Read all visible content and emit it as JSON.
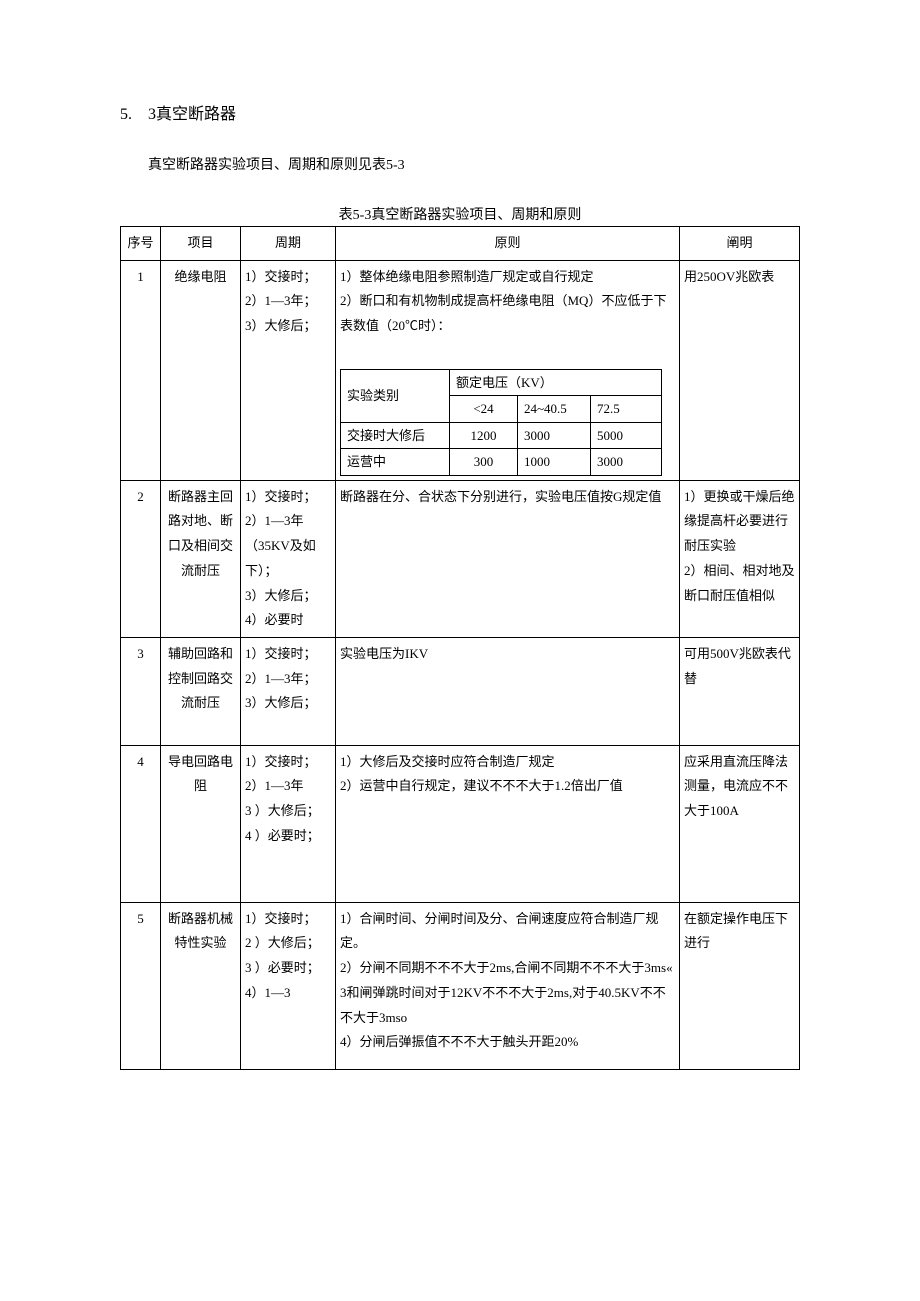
{
  "section_title": "5.　3真空断路器",
  "intro": "真空断路器实验项目、周期和原则见表5-3",
  "table_caption": "表5-3真空断路器实验项目、周期和原则",
  "headers": {
    "seq": "序号",
    "item": "项目",
    "period": "周期",
    "principle": "原则",
    "note": "阐明"
  },
  "row1": {
    "seq": "1",
    "item": "绝缘电阻",
    "period": "1）交接时；\n2）1—3年；\n3）大修后；",
    "principle_top": "1）整体绝缘电阻参照制造厂规定或自行规定\n2）断口和有机物制成提高杆绝缘电阻（MQ）不应低于下表数值（20℃时）：",
    "note": "用250OV兆欧表",
    "inner": {
      "h1": "实验类别",
      "h2": "额定电压（KV）",
      "c1": "<24",
      "c2": "24~40.5",
      "c3": "72.5",
      "r1_label": "交接时大修后",
      "r1_1": "1200",
      "r1_2": "3000",
      "r1_3": "5000",
      "r2_label": "运营中",
      "r2_1": "300",
      "r2_2": "1000",
      "r2_3": "3000"
    }
  },
  "row2": {
    "seq": "2",
    "item": "断路器主回路对地、断口及相间交流耐压",
    "period": "1）交接时；\n2）1—3年（35KV及如下）；\n3）大修后；\n4）必要时",
    "principle": "断路器在分、合状态下分别进行，实验电压值按G规定值",
    "note": "1）更换或干燥后绝缘提高杆必要进行耐压实验\n2）相间、相对地及断口耐压值相似"
  },
  "row3": {
    "seq": "3",
    "item": "辅助回路和控制回路交流耐压",
    "period": "1）交接时；\n2）1—3年；\n3）大修后；\n\n",
    "principle": "实验电压为IKV",
    "note": "可用500V兆欧表代替"
  },
  "row4": {
    "seq": "4",
    "item": "导电回路电阻",
    "period": "1）交接时；\n2）1—3年\n3 ）大修后；\n4 ）必要时；\n\n\n",
    "principle": "1）大修后及交接时应符合制造厂规定\n2）运营中自行规定，建议不不不大于1.2倍出厂值",
    "note": "应采用直流压降法测量，电流应不不大于100A"
  },
  "row5": {
    "seq": "5",
    "item": "断路器机械特性实验",
    "period": "1）交接时；\n2 ）大修后；\n3 ）必要时；\n4）1—3",
    "principle": "1）合闸时间、分闸时间及分、合闸速度应符合制造厂规定。\n2）分闸不同期不不不大于2ms,合闸不同期不不不大于3ms«\n3和闸弹跳时间对于12KV不不不大于2ms,对于40.5KV不不不大于3mso\n4）分闸后弹振值不不不大于触头开距20%",
    "note": "在额定操作电压下进行"
  }
}
